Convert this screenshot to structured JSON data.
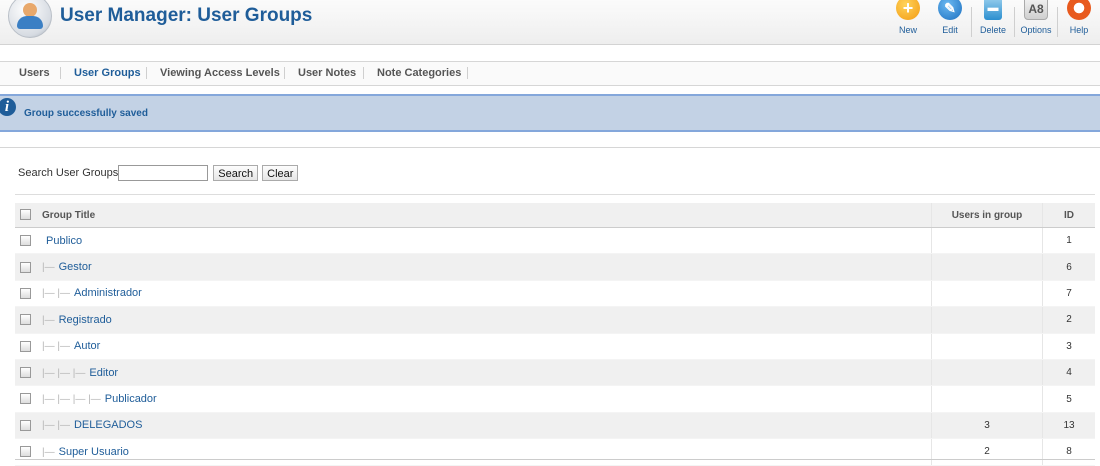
{
  "header": {
    "title": "User Manager: User Groups",
    "toolbar": [
      {
        "label": "New",
        "icon": "plus-icon",
        "glyph": "+"
      },
      {
        "label": "Edit",
        "icon": "pencil-icon",
        "glyph": "✎"
      },
      {
        "label": "Delete",
        "icon": "trash-icon",
        "glyph": "▬"
      },
      {
        "label": "Options",
        "icon": "options-icon",
        "glyph": "A8"
      },
      {
        "label": "Help",
        "icon": "lifebuoy-icon",
        "glyph": ""
      }
    ]
  },
  "submenu": {
    "items": [
      "Users",
      "User Groups",
      "Viewing Access Levels",
      "User Notes",
      "Note Categories"
    ],
    "active": "User Groups"
  },
  "message": {
    "text": "Group successfully saved",
    "icon": "info-icon"
  },
  "filter": {
    "label": "Search User Groups",
    "value": "",
    "search_label": "Search",
    "clear_label": "Clear"
  },
  "table": {
    "headers": {
      "title": "Group Title",
      "users": "Users in group",
      "id": "ID"
    },
    "rows": [
      {
        "indent": "",
        "title": "Publico",
        "users": "",
        "id": "1"
      },
      {
        "indent": "|—",
        "title": "Gestor",
        "users": "",
        "id": "6"
      },
      {
        "indent": "|— |—",
        "title": "Administrador",
        "users": "",
        "id": "7"
      },
      {
        "indent": "|—",
        "title": "Registrado",
        "users": "",
        "id": "2"
      },
      {
        "indent": "|— |—",
        "title": "Autor",
        "users": "",
        "id": "3"
      },
      {
        "indent": "|— |— |—",
        "title": "Editor",
        "users": "",
        "id": "4"
      },
      {
        "indent": "|— |— |— |—",
        "title": "Publicador",
        "users": "",
        "id": "5"
      },
      {
        "indent": "|— |—",
        "title": "DELEGADOS",
        "users": "3",
        "id": "13"
      },
      {
        "indent": "|—",
        "title": "Super Usuario",
        "users": "2",
        "id": "8"
      }
    ]
  },
  "colors": {
    "accent": "#1f5d99",
    "message_bg": "#c3d2e5",
    "message_border": "#84a7db"
  }
}
